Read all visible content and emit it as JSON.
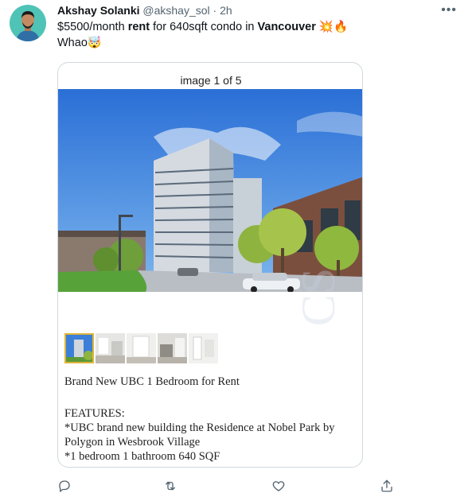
{
  "tweet": {
    "author_name": "Akshay Solanki",
    "handle": "@akshay_sol",
    "separator": "·",
    "time": "2h",
    "text_part1": "$5500/month ",
    "text_bold1": "rent",
    "text_part2": " for 640sqft condo in ",
    "text_bold2": "Vancouver",
    "text_emoji1": " 💥🔥",
    "text_line2": "Whao🤯"
  },
  "media": {
    "counter": "image 1 of 5",
    "watermark": "CS",
    "listing_title": "Brand New UBC 1 Bedroom for Rent",
    "features_heading": "FEATURES:",
    "features": [
      "*UBC brand new building the Residence at Nobel Park by Polygon in Wesbrook Village",
      "*1 bedroom 1 bathroom 640 SQF"
    ]
  },
  "icons": {
    "more": "more-options-icon",
    "reply": "reply-icon",
    "retweet": "retweet-icon",
    "like": "like-icon",
    "share": "share-icon"
  },
  "colors": {
    "icon_gray": "#536471",
    "text": "#0f1419",
    "avatar_bg": "#4fc3b6",
    "thumb_active": "#e0b43a"
  }
}
